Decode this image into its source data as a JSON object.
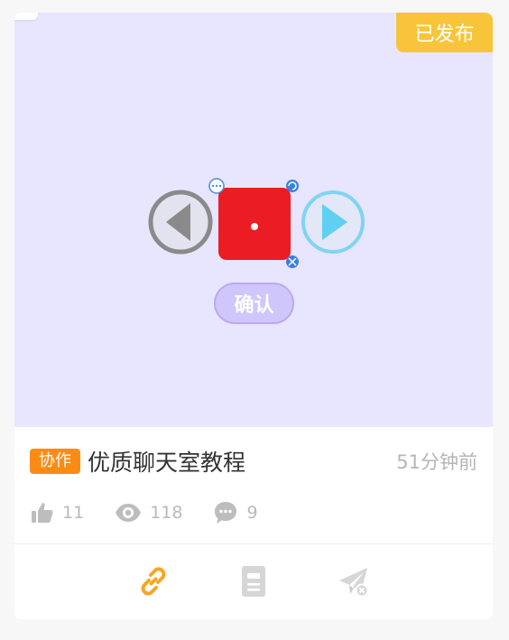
{
  "card": {
    "status_badge": "已发布",
    "tag": "协作",
    "title": "优质聊天室教程",
    "time_ago": "51分钟前",
    "stats": {
      "likes": "11",
      "views": "118",
      "comments": "9"
    },
    "thumbnail": {
      "confirm_label": "确认"
    }
  },
  "colors": {
    "badge": "#f8c53a",
    "tag": "#fa8c16",
    "link_icon": "#f5a623",
    "thumbnail_bg": "#e8e5ff"
  },
  "icons": [
    "like-icon",
    "eye-icon",
    "comment-icon",
    "link-icon",
    "document-icon",
    "send-disabled-icon"
  ]
}
